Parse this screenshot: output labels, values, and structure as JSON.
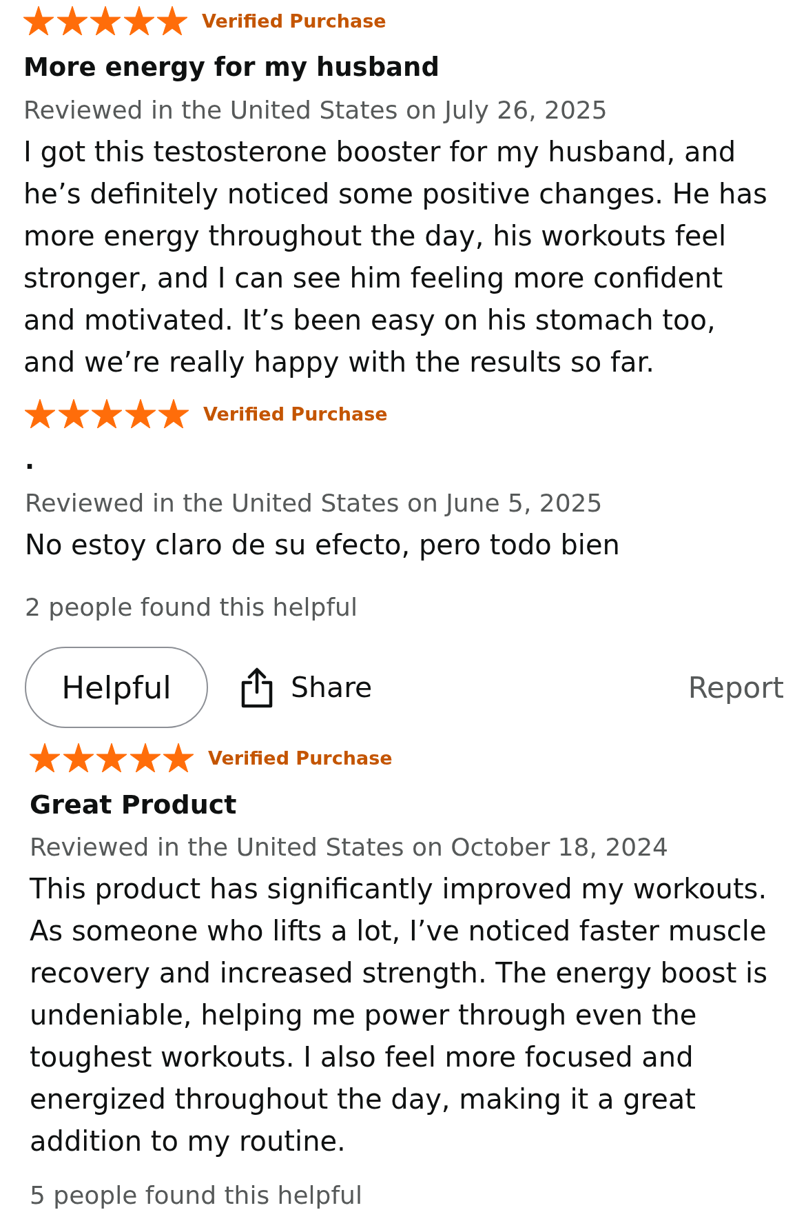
{
  "reviews": [
    {
      "stars": 5,
      "badge": "Verified Purchase",
      "title": "More energy for my husband",
      "date": "Reviewed in the United States on July 26, 2025",
      "body": "I got this testosterone booster for my husband, and he’s definitely noticed some positive changes. He has more energy throughout the day, his workouts feel stronger, and I can see him feeling more confident and motivated. It’s been easy on his stomach too, and we’re really happy with the results so far."
    },
    {
      "stars": 5,
      "badge": "Verified Purchase",
      "title": ".",
      "date": "Reviewed in the United States on June 5, 2025",
      "body": "No estoy claro de su efecto, pero todo bien",
      "helpful_count": "2 people found this helpful",
      "actions": {
        "helpful": "Helpful",
        "share": "Share",
        "report": "Report"
      }
    },
    {
      "stars": 5,
      "badge": "Verified Purchase",
      "title": "Great Product",
      "date": "Reviewed in the United States on October 18, 2024",
      "body": "This product has significantly improved my workouts. As someone who lifts a lot, I’ve noticed faster muscle recovery and increased strength. The energy boost is undeniable, helping me power through even the toughest workouts. I also feel more focused and energized throughout the day, making it a great addition to my routine.",
      "helpful_count": "5 people found this helpful"
    }
  ]
}
